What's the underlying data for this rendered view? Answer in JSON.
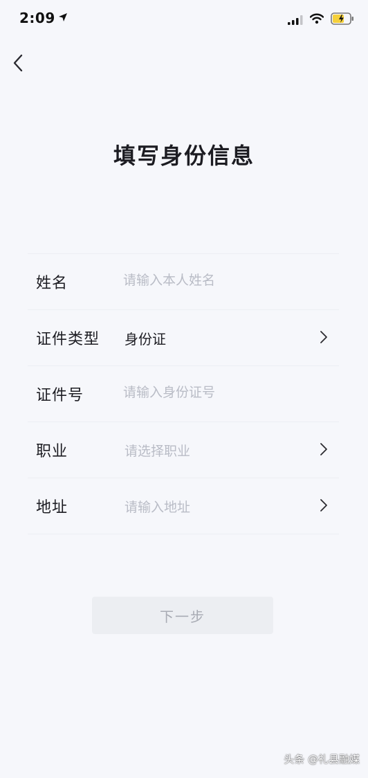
{
  "status_bar": {
    "time": "2:09"
  },
  "header": {
    "back_icon": "chevron-left-icon",
    "title": "填写身份信息"
  },
  "form": {
    "name": {
      "label": "姓名",
      "placeholder": "请输入本人姓名"
    },
    "id_type": {
      "label": "证件类型",
      "value": "身份证"
    },
    "id_number": {
      "label": "证件号",
      "placeholder": "请输入身份证号"
    },
    "occupation": {
      "label": "职业",
      "placeholder": "请选择职业"
    },
    "address": {
      "label": "地址",
      "placeholder": "请输入地址"
    }
  },
  "actions": {
    "next_label": "下一步"
  },
  "watermark": "头条 @礼县融媒",
  "colors": {
    "background": "#f6f7fb",
    "text": "#1c1c22",
    "placeholder": "#b9bcc6",
    "button_disabled_bg": "#eceef2",
    "button_disabled_text": "#a8abb4",
    "battery_yellow": "#f5d03b"
  }
}
